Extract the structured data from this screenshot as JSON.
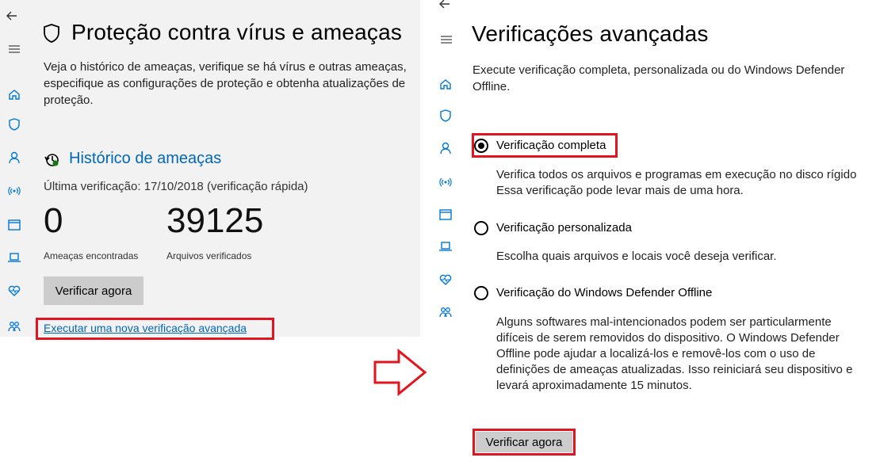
{
  "left": {
    "title": "Proteção contra vírus e ameaças",
    "description": "Veja o histórico de ameaças, verifique se há vírus e outras ameaças, especifique as configurações de proteção e obtenha atualizações de proteção.",
    "history_title": "Histórico de ameaças",
    "last_scan": "Última verificação: 17/10/2018 (verificação rápida)",
    "threats_count": "0",
    "threats_label": "Ameaças encontradas",
    "files_count": "39125",
    "files_label": "Arquivos verificados",
    "scan_now_button": "Verificar agora",
    "advanced_scan_link": "Executar uma nova verificação avançada"
  },
  "right": {
    "title": "Verificações avançadas",
    "description": "Execute verificação completa, personalizada ou do Windows Defender Offline.",
    "options": [
      {
        "label": "Verificação completa",
        "description": "Verifica todos os arquivos e programas em execução no disco rígido Essa verificação pode levar mais de uma hora.",
        "selected": true
      },
      {
        "label": "Verificação personalizada",
        "description": "Escolha quais arquivos e locais você deseja verificar.",
        "selected": false
      },
      {
        "label": "Verificação do Windows Defender Offline",
        "description": "Alguns softwares mal-intencionados podem ser particularmente difíceis de serem removidos do dispositivo. O Windows Defender Offline pode ajudar a localizá-los e removê-los com o uso de definições de ameaças atualizadas. Isso reiniciará seu dispositivo e levará aproximadamente 15 minutos.",
        "selected": false
      }
    ],
    "scan_now_button": "Verificar agora"
  },
  "nav_icons": [
    "back-icon",
    "hamburger-icon",
    "home-icon",
    "shield-icon",
    "person-icon",
    "wireless-icon",
    "browser-icon",
    "laptop-icon",
    "heart-icon",
    "family-icon"
  ],
  "colors": {
    "accent": "#0067b8",
    "highlight": "#e3141e",
    "icon_blue": "#0078d7",
    "button_gray": "#cccccc",
    "panel_gray": "#f2f2f2"
  }
}
